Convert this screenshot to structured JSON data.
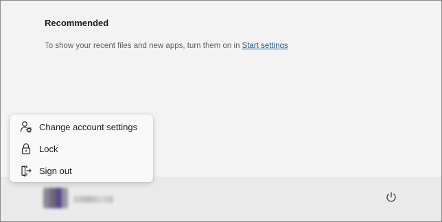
{
  "recommended": {
    "heading": "Recommended",
    "message": "To show your recent files and new apps, turn them on in ",
    "link_label": "Start settings"
  },
  "account_menu": {
    "items": [
      {
        "label": "Change account settings",
        "icon": "person-gear-icon"
      },
      {
        "label": "Lock",
        "icon": "lock-icon"
      },
      {
        "label": "Sign out",
        "icon": "sign-out-icon"
      }
    ]
  },
  "bottom_bar": {
    "user_avatar": "avatar",
    "user_name": "",
    "power_icon": "power-icon"
  },
  "colors": {
    "panel_bg": "#f3f3f3",
    "bottom_bar_bg": "#eaeaea",
    "menu_bg": "#f9f9f9",
    "link": "#1a5c8c",
    "text": "#1b1b1b",
    "muted_text": "#5f5f5f"
  }
}
